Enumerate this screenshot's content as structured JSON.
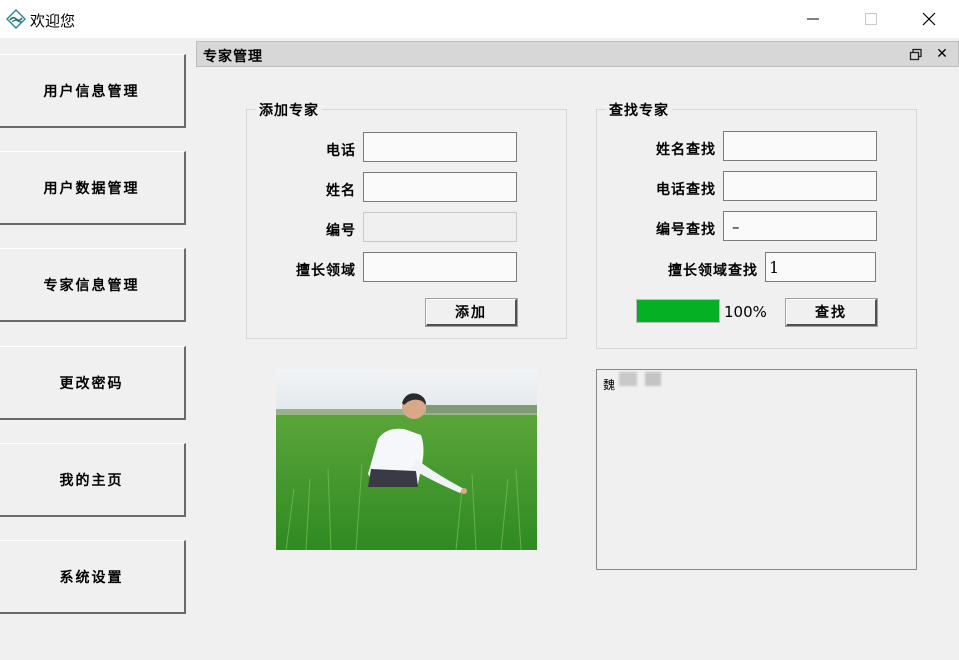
{
  "window": {
    "title": "欢迎您",
    "icon": "app-logo-icon",
    "controls": {
      "minimize": "minimize-icon",
      "maximize": "maximize-icon",
      "close": "close-icon"
    }
  },
  "sidebar": {
    "items": [
      {
        "label": "用户信息管理"
      },
      {
        "label": "用户数据管理"
      },
      {
        "label": "专家信息管理"
      },
      {
        "label": "更改密码"
      },
      {
        "label": "我的主页"
      },
      {
        "label": "系统设置"
      }
    ]
  },
  "child_window": {
    "title": "专家管理",
    "restore_icon": "restore-icon",
    "close_glyph": "✕"
  },
  "add_expert": {
    "legend": "添加专家",
    "phone_label": "电话",
    "phone_value": "",
    "name_label": "姓名",
    "name_value": "",
    "id_label": "编号",
    "id_value": "",
    "field_label": "擅长领域",
    "field_value": "",
    "add_button": "添加"
  },
  "find_expert": {
    "legend": "查找专家",
    "name_label": "姓名查找",
    "name_value": "",
    "phone_label": "电话查找",
    "phone_value": "",
    "id_label": "编号查找",
    "id_value": "–",
    "field_label": "擅长领域查找",
    "field_value": "1",
    "progress_fraction": 1.0,
    "progress_text": "100%",
    "search_button": "查找"
  },
  "result": {
    "text": "魏"
  },
  "colors": {
    "progress_fill": "#06b025",
    "window_bg": "#f0f0f0"
  }
}
